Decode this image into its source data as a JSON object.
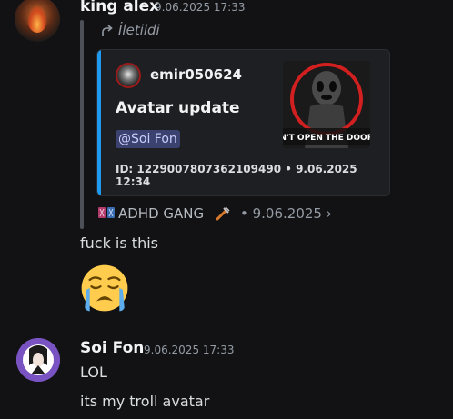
{
  "message1": {
    "username": "king alex",
    "timestamp": "9.06.2025 17:33",
    "forwarded_label": "İletildi",
    "embed": {
      "author": "emir050624",
      "title": "Avatar update",
      "mention": "@Soi Fon",
      "footer": "ID: 1229007807362109490 • 9.06.2025 12:34",
      "thumbnail_text": "N'T OPEN THE DOOR"
    },
    "guild": {
      "name": "ADHD GANG",
      "date_sep": "• 9.06.2025 ›"
    },
    "text": "fuck is this",
    "emoji": "loudly-crying-face"
  },
  "message2": {
    "username": "Soi Fon",
    "timestamp": "9.06.2025 17:33",
    "lines": [
      "LOL",
      "its my troll avatar"
    ]
  },
  "colors": {
    "background": "#121214",
    "embed_accent": "#1e9bf0",
    "mention_bg": "#3c4270",
    "mention_text": "#c9cdfb"
  }
}
